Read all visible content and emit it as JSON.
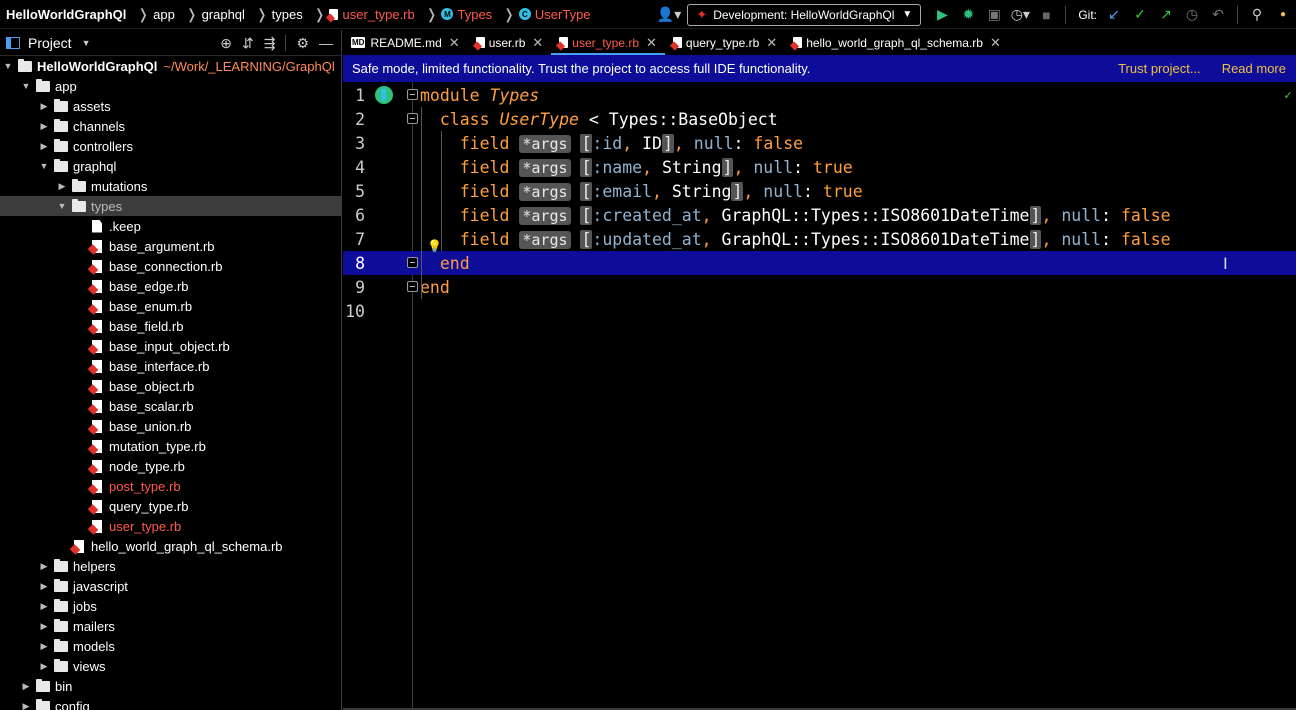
{
  "navbar": {
    "breadcrumbs": [
      {
        "label": "HelloWorldGraphQl",
        "type": "root"
      },
      {
        "label": "app",
        "type": "folder"
      },
      {
        "label": "graphql",
        "type": "folder"
      },
      {
        "label": "types",
        "type": "folder"
      },
      {
        "label": "user_type.rb",
        "type": "ruby-file"
      },
      {
        "label": "Types",
        "type": "module"
      },
      {
        "label": "UserType",
        "type": "class"
      }
    ],
    "run_config": "Development: HelloWorldGraphQl",
    "git_label": "Git:"
  },
  "project_panel": {
    "title": "Project",
    "tree": [
      {
        "depth": 0,
        "kind": "folder",
        "expanded": true,
        "name": "HelloWorldGraphQl",
        "path": "~/Work/_LEARNING/GraphQl",
        "bold": true
      },
      {
        "depth": 1,
        "kind": "folder",
        "expanded": true,
        "name": "app"
      },
      {
        "depth": 2,
        "kind": "folder",
        "expanded": false,
        "name": "assets"
      },
      {
        "depth": 2,
        "kind": "folder",
        "expanded": false,
        "name": "channels"
      },
      {
        "depth": 2,
        "kind": "folder",
        "expanded": false,
        "name": "controllers"
      },
      {
        "depth": 2,
        "kind": "folder",
        "expanded": true,
        "name": "graphql"
      },
      {
        "depth": 3,
        "kind": "folder",
        "expanded": false,
        "name": "mutations"
      },
      {
        "depth": 3,
        "kind": "folder",
        "expanded": true,
        "name": "types",
        "selected": true,
        "dim": true
      },
      {
        "depth": 4,
        "kind": "file",
        "name": ".keep"
      },
      {
        "depth": 4,
        "kind": "rb",
        "name": "base_argument.rb"
      },
      {
        "depth": 4,
        "kind": "rb",
        "name": "base_connection.rb"
      },
      {
        "depth": 4,
        "kind": "rb",
        "name": "base_edge.rb"
      },
      {
        "depth": 4,
        "kind": "rb",
        "name": "base_enum.rb"
      },
      {
        "depth": 4,
        "kind": "rb",
        "name": "base_field.rb"
      },
      {
        "depth": 4,
        "kind": "rb",
        "name": "base_input_object.rb"
      },
      {
        "depth": 4,
        "kind": "rb",
        "name": "base_interface.rb"
      },
      {
        "depth": 4,
        "kind": "rb",
        "name": "base_object.rb"
      },
      {
        "depth": 4,
        "kind": "rb",
        "name": "base_scalar.rb"
      },
      {
        "depth": 4,
        "kind": "rb",
        "name": "base_union.rb"
      },
      {
        "depth": 4,
        "kind": "rb",
        "name": "mutation_type.rb"
      },
      {
        "depth": 4,
        "kind": "rb",
        "name": "node_type.rb"
      },
      {
        "depth": 4,
        "kind": "rb",
        "name": "post_type.rb",
        "red": true
      },
      {
        "depth": 4,
        "kind": "rb",
        "name": "query_type.rb"
      },
      {
        "depth": 4,
        "kind": "rb",
        "name": "user_type.rb",
        "red": true
      },
      {
        "depth": 3,
        "kind": "rb",
        "name": "hello_world_graph_ql_schema.rb"
      },
      {
        "depth": 2,
        "kind": "folder",
        "expanded": false,
        "name": "helpers"
      },
      {
        "depth": 2,
        "kind": "folder",
        "expanded": false,
        "name": "javascript"
      },
      {
        "depth": 2,
        "kind": "folder",
        "expanded": false,
        "name": "jobs"
      },
      {
        "depth": 2,
        "kind": "folder",
        "expanded": false,
        "name": "mailers"
      },
      {
        "depth": 2,
        "kind": "folder",
        "expanded": false,
        "name": "models"
      },
      {
        "depth": 2,
        "kind": "folder",
        "expanded": false,
        "name": "views"
      },
      {
        "depth": 1,
        "kind": "folder",
        "expanded": false,
        "name": "bin"
      },
      {
        "depth": 1,
        "kind": "folder",
        "expanded": false,
        "name": "config"
      }
    ]
  },
  "tabs": [
    {
      "label": "README.md",
      "icon": "markdown-icon",
      "active": false
    },
    {
      "label": "user.rb",
      "icon": "ruby-icon",
      "active": false
    },
    {
      "label": "user_type.rb",
      "icon": "ruby-icon",
      "active": true
    },
    {
      "label": "query_type.rb",
      "icon": "ruby-icon",
      "active": false
    },
    {
      "label": "hello_world_graph_ql_schema.rb",
      "icon": "ruby-icon",
      "active": false
    }
  ],
  "banner": {
    "message": "Safe mode, limited functionality. Trust the project to access full IDE functionality.",
    "trust_link": "Trust project...",
    "read_more_link": "Read more"
  },
  "editor": {
    "current_line": 8,
    "lines": [
      {
        "n": "1",
        "tokens": [
          [
            "kw",
            "module "
          ],
          [
            "cls",
            "Types"
          ]
        ]
      },
      {
        "n": "2",
        "tokens": [
          [
            "plain",
            "  "
          ],
          [
            "kw",
            "class "
          ],
          [
            "cls",
            "UserType"
          ],
          [
            "plain",
            " < Types::BaseObject"
          ]
        ]
      },
      {
        "n": "3",
        "tokens": [
          [
            "plain",
            "    "
          ],
          [
            "kw",
            "field "
          ],
          [
            "hint",
            "*args"
          ],
          [
            "plain",
            " "
          ],
          [
            "brk",
            "["
          ],
          [
            "sym",
            ":id"
          ],
          [
            "kw",
            ", "
          ],
          [
            "plain",
            "ID"
          ],
          [
            "brk",
            "]"
          ],
          [
            "kw",
            ", "
          ],
          [
            "nul",
            "null"
          ],
          [
            "plain",
            ": "
          ],
          [
            "bool",
            "false"
          ]
        ]
      },
      {
        "n": "4",
        "tokens": [
          [
            "plain",
            "    "
          ],
          [
            "kw",
            "field "
          ],
          [
            "hint",
            "*args"
          ],
          [
            "plain",
            " "
          ],
          [
            "brk",
            "["
          ],
          [
            "sym",
            ":name"
          ],
          [
            "kw",
            ", "
          ],
          [
            "plain",
            "String"
          ],
          [
            "brk",
            "]"
          ],
          [
            "kw",
            ", "
          ],
          [
            "nul",
            "null"
          ],
          [
            "plain",
            ": "
          ],
          [
            "bool",
            "true"
          ]
        ]
      },
      {
        "n": "5",
        "tokens": [
          [
            "plain",
            "    "
          ],
          [
            "kw",
            "field "
          ],
          [
            "hint",
            "*args"
          ],
          [
            "plain",
            " "
          ],
          [
            "brk",
            "["
          ],
          [
            "sym",
            ":email"
          ],
          [
            "kw",
            ", "
          ],
          [
            "plain",
            "String"
          ],
          [
            "brk",
            "]"
          ],
          [
            "kw",
            ", "
          ],
          [
            "nul",
            "null"
          ],
          [
            "plain",
            ": "
          ],
          [
            "bool",
            "true"
          ]
        ]
      },
      {
        "n": "6",
        "tokens": [
          [
            "plain",
            "    "
          ],
          [
            "kw",
            "field "
          ],
          [
            "hint",
            "*args"
          ],
          [
            "plain",
            " "
          ],
          [
            "brk",
            "["
          ],
          [
            "sym",
            ":created_at"
          ],
          [
            "kw",
            ", "
          ],
          [
            "plain",
            "GraphQL::Types::ISO8601DateTime"
          ],
          [
            "brk",
            "]"
          ],
          [
            "kw",
            ", "
          ],
          [
            "nul",
            "null"
          ],
          [
            "plain",
            ": "
          ],
          [
            "bool",
            "false"
          ]
        ]
      },
      {
        "n": "7",
        "tokens": [
          [
            "plain",
            "    "
          ],
          [
            "kw",
            "field "
          ],
          [
            "hint",
            "*args"
          ],
          [
            "plain",
            " "
          ],
          [
            "brk",
            "["
          ],
          [
            "sym",
            ":updated_at"
          ],
          [
            "kw",
            ", "
          ],
          [
            "plain",
            "GraphQL::Types::ISO8601DateTime"
          ],
          [
            "brk",
            "]"
          ],
          [
            "kw",
            ", "
          ],
          [
            "nul",
            "null"
          ],
          [
            "plain",
            ": "
          ],
          [
            "bool",
            "false"
          ]
        ]
      },
      {
        "n": "8",
        "tokens": [
          [
            "plain",
            "  "
          ],
          [
            "kw",
            "end"
          ]
        ]
      },
      {
        "n": "9",
        "tokens": [
          [
            "kw",
            "end"
          ]
        ]
      },
      {
        "n": "10",
        "tokens": []
      }
    ]
  },
  "colors": {
    "banner_bg": "#0d0d99",
    "keyword": "#ff9e40",
    "symbol": "#8fb3d0",
    "modified_file": "#ff5a4e",
    "link": "#f0c040",
    "accent": "#4aa0f0"
  }
}
